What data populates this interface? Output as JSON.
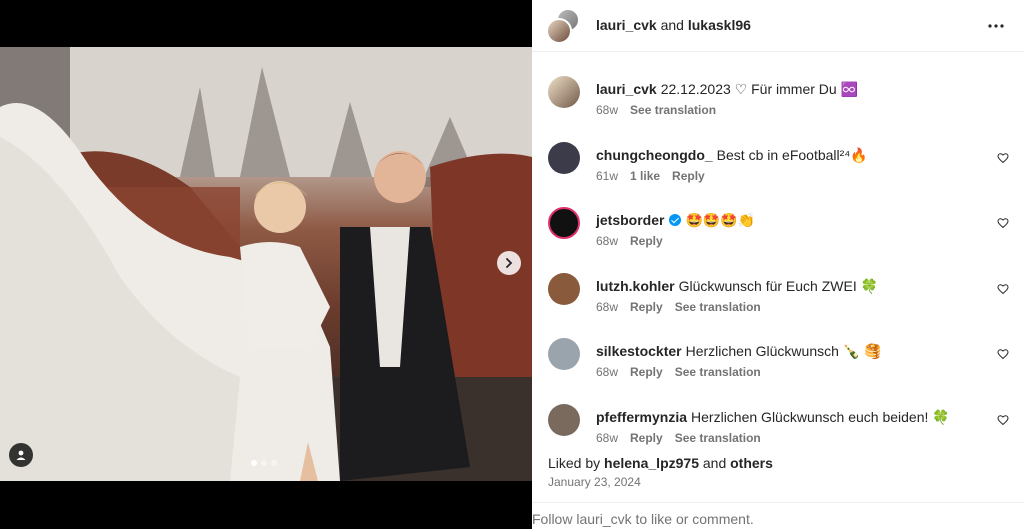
{
  "header": {
    "user1": "lauri_cvk",
    "joiner": "and",
    "user2": "lukaskl96"
  },
  "caption": {
    "username": "lauri_cvk",
    "text": "22.12.2023 ♡ Für immer Du ♾️",
    "time": "68w",
    "see_translation": "See translation"
  },
  "comments": [
    {
      "username": "chungcheongdo_",
      "text": "Best cb in eFootball²⁴🔥",
      "time": "61w",
      "likes": "1 like",
      "reply": "Reply",
      "translation": "",
      "verified": false,
      "avatar_color": "#3b3b4a"
    },
    {
      "username": "jetsborder",
      "text": "🤩🤩🤩👏",
      "time": "68w",
      "likes": "",
      "reply": "Reply",
      "translation": "",
      "verified": true,
      "avatar_color": "#111111"
    },
    {
      "username": "lutzh.kohler",
      "text": "Glückwunsch für Euch ZWEI 🍀",
      "time": "68w",
      "likes": "",
      "reply": "Reply",
      "translation": "See translation",
      "verified": false,
      "avatar_color": "#8a5a3c"
    },
    {
      "username": "silkestockter",
      "text": "Herzlichen Glückwunsch 🍾 🥞",
      "time": "68w",
      "likes": "",
      "reply": "Reply",
      "translation": "See translation",
      "verified": false,
      "avatar_color": "#9aa4ad"
    },
    {
      "username": "pfeffermynzia",
      "text": "Herzlichen Glückwunsch euch beiden! 🍀",
      "time": "68w",
      "likes": "",
      "reply": "Reply",
      "translation": "See translation",
      "verified": false,
      "avatar_color": "#7a6a5e"
    }
  ],
  "likes": {
    "prefix": "Liked by",
    "user": "helena_lpz975",
    "joiner": "and",
    "others": "others"
  },
  "post_date": "January 23, 2024",
  "footer": "Follow lauri_cvk to like or comment.",
  "carousel": {
    "slides": 3,
    "active": 1
  },
  "icons": {
    "more": "more-horizontal-icon",
    "next": "chevron-right-icon",
    "tag": "user-tag-icon",
    "like": "heart-icon"
  },
  "colors": {
    "verified": "#0095f6",
    "meta": "#737373",
    "text": "#262626"
  }
}
